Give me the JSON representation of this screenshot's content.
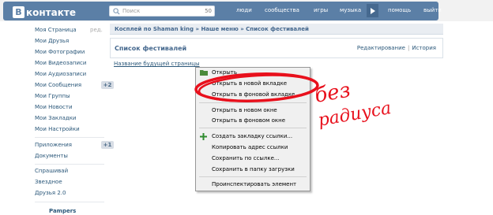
{
  "header": {
    "logo_letter": "В",
    "logo_text": "контакте",
    "search": {
      "placeholder": "Поиск",
      "count": "50"
    },
    "nav": [
      "люди",
      "сообщества",
      "игры",
      "музыка",
      "помощь",
      "выйти"
    ]
  },
  "sidebar": {
    "items": [
      {
        "label": "Моя Страница",
        "extra": "ред."
      },
      {
        "label": "Мои Друзья"
      },
      {
        "label": "Мои Фотографии"
      },
      {
        "label": "Мои Видеозаписи"
      },
      {
        "label": "Мои Аудиозаписи"
      },
      {
        "label": "Мои Сообщения",
        "badge": "+2"
      },
      {
        "label": "Мои Группы"
      },
      {
        "label": "Мои Новости"
      },
      {
        "label": "Мои Закладки"
      },
      {
        "label": "Мои Настройки"
      },
      {
        "label": "Приложения",
        "badge": "+1"
      },
      {
        "label": "Документы"
      },
      {
        "label": "Спрашивай"
      },
      {
        "label": "Звездное"
      },
      {
        "label": "Друзья 2.0"
      }
    ],
    "footer": "Pampers"
  },
  "main": {
    "breadcrumb": "Косплей по Shaman king » Наше меню » Список фестивалей",
    "page_title": "Список фестивалей",
    "links": {
      "edit": "Редактирование",
      "history": "История"
    },
    "future_page_link": "Название будущей страницы"
  },
  "context_menu": {
    "items": [
      "Открыть",
      "Открыть в новой вкладке",
      "Открыть в фоновой вкладке",
      "Открыть в новом окне",
      "Открыть в фоновом окне",
      "Создать закладку ссылки...",
      "Копировать адрес ссылки",
      "Сохранить по ссылке...",
      "Сохранить в папку загрузки",
      "Проинспектировать элемент"
    ]
  },
  "annotation": {
    "line1": "без",
    "line2": "радиуса",
    "color": "#e8101c"
  },
  "colors": {
    "header": "#5b7fa6",
    "link": "#2b587a",
    "annotation": "#e8101c"
  }
}
